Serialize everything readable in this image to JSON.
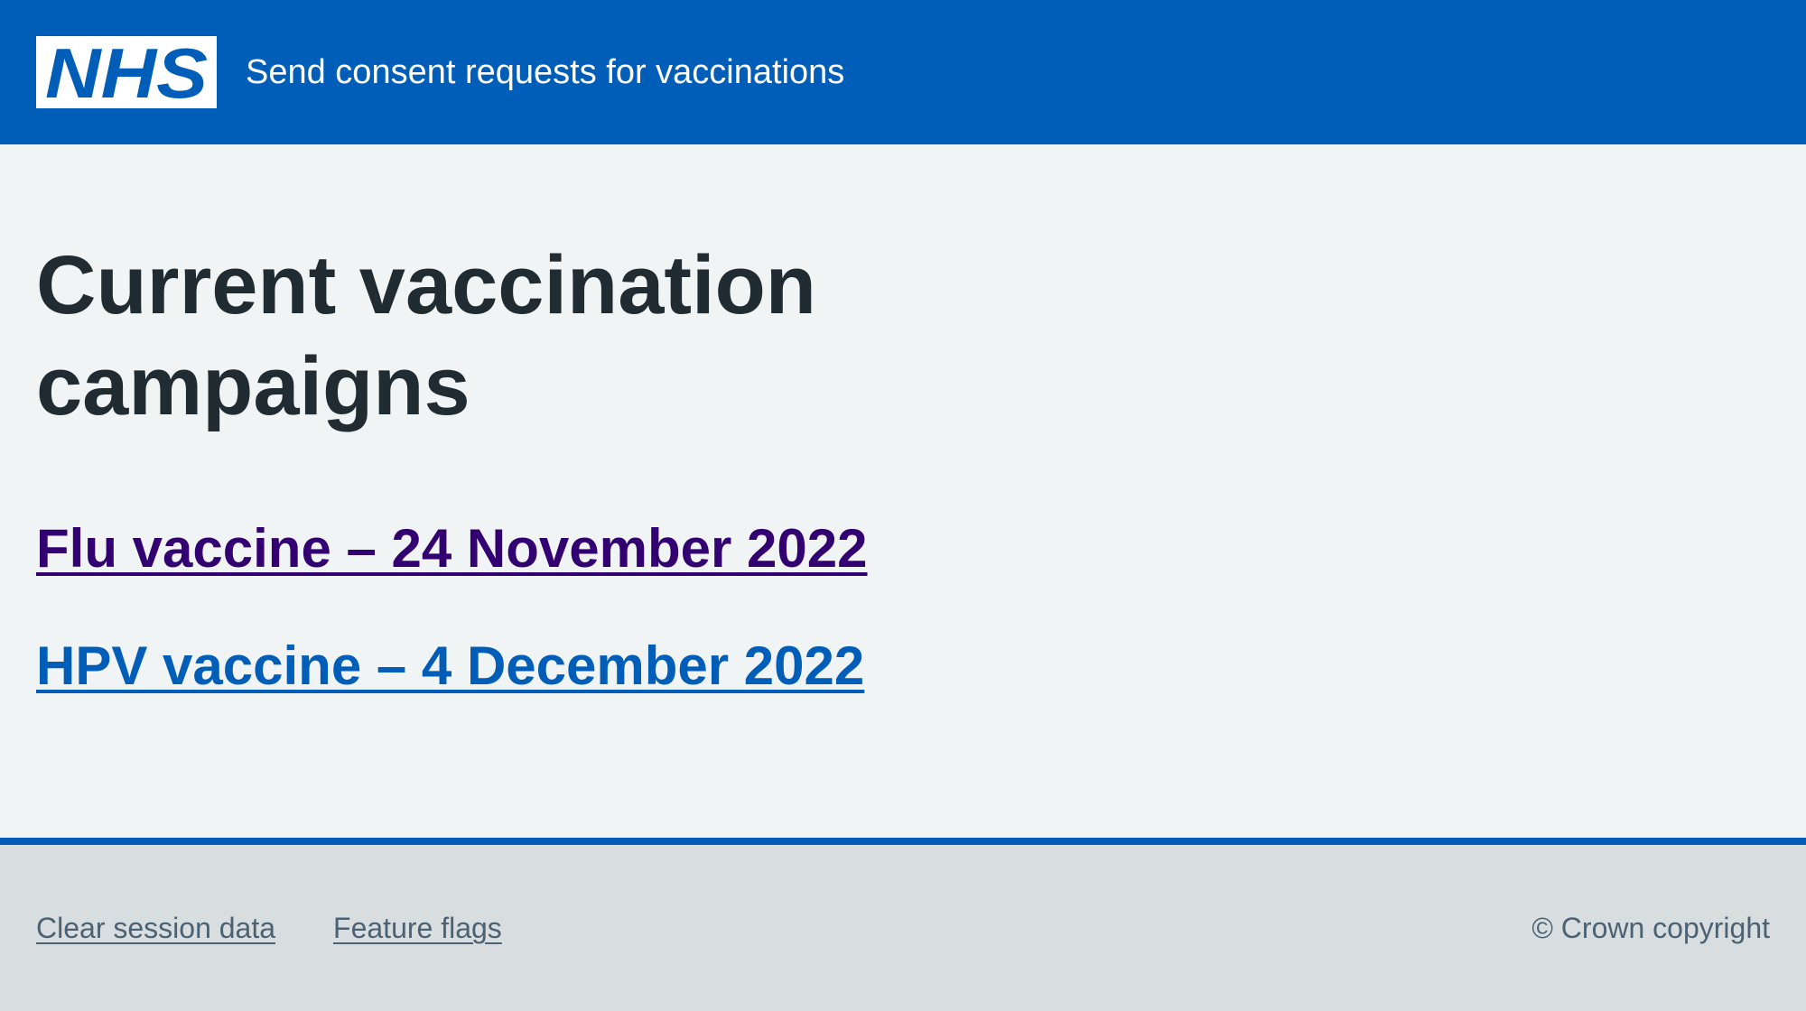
{
  "header": {
    "logo_text": "NHS",
    "service_name": "Send consent requests for vaccinations"
  },
  "main": {
    "title": "Current vaccination campaigns",
    "campaigns": [
      {
        "label": "Flu vaccine – 24 November 2022",
        "state": "visited"
      },
      {
        "label": "HPV vaccine – 4 December 2022",
        "state": "unvisited"
      }
    ]
  },
  "footer": {
    "links": [
      {
        "label": "Clear session data"
      },
      {
        "label": "Feature flags"
      }
    ],
    "copyright": "© Crown copyright"
  },
  "colors": {
    "nhs_blue": "#005eb8",
    "visited_link": "#330072",
    "text": "#212b32",
    "secondary_text": "#4c6272",
    "page_background": "#f0f4f5",
    "footer_background": "#d8dde0"
  }
}
